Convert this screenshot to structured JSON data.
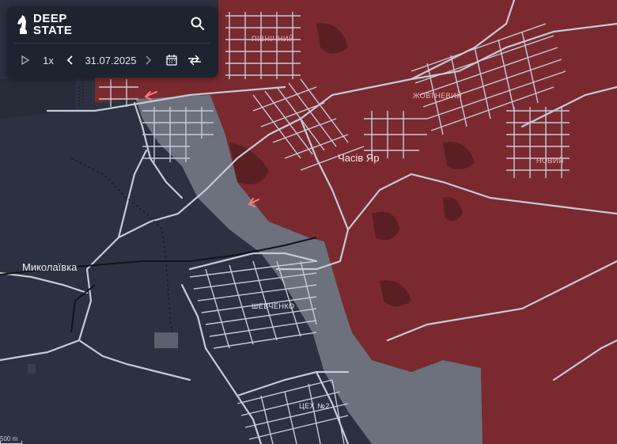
{
  "app": {
    "brand_line1": "DEEP",
    "brand_line2": "STATE"
  },
  "toolbar": {
    "speed_label": "1x",
    "date": "31.07.2025",
    "icons": [
      "play-icon",
      "chevron-left-icon",
      "chevron-right-icon",
      "calendar-icon",
      "compare-icon",
      "search-icon"
    ]
  },
  "map": {
    "labels": {
      "pivnichnyi": "ПІВНІЧНИЙ",
      "zhovtnevyi": "ЖОВТНЕВИЙ",
      "chasiv_yar": "Часів Яр",
      "novyi": "НОВИЙ",
      "mykolaivka": "Миколаївка",
      "shevchenko": "ШЕВЧЕНКО",
      "tsekh2": "ЦЕХ №2"
    },
    "scale_label": "500 m",
    "colors": {
      "occupied": "#7a2a2e",
      "contested": "#6f7480",
      "ukrainian": "#2b3140",
      "roads": "#c6cad6",
      "arrow": "#ff7a7a"
    }
  }
}
